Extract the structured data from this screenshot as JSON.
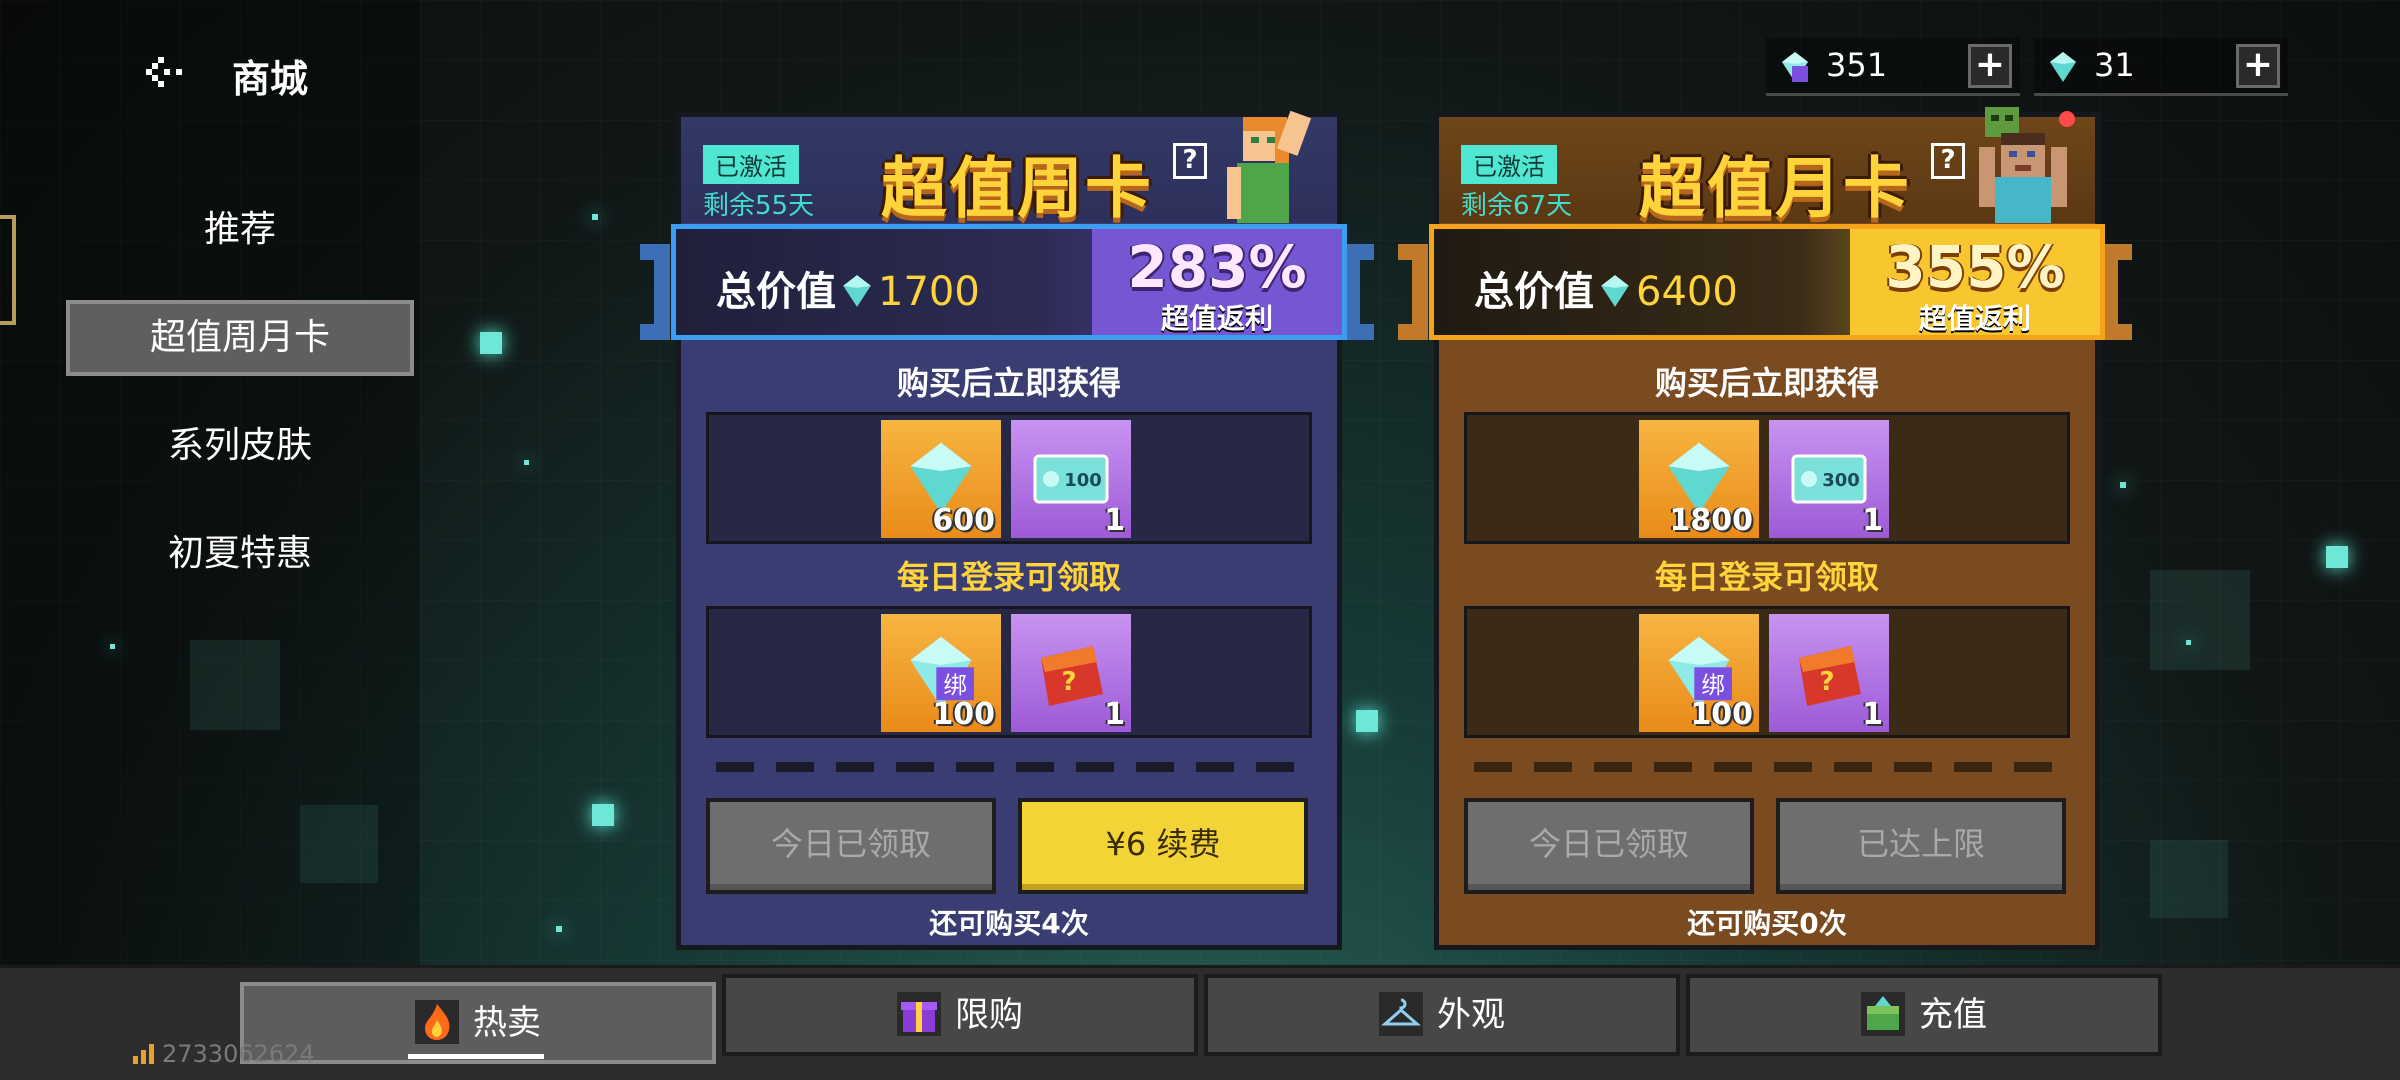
{
  "header": {
    "title": "商城",
    "back_icon": "back-arrow-icon"
  },
  "sidebar": {
    "items": [
      {
        "label": "推荐",
        "active": false
      },
      {
        "label": "超值周月卡",
        "active": true
      },
      {
        "label": "系列皮肤",
        "active": false
      },
      {
        "label": "初夏特惠",
        "active": false
      }
    ]
  },
  "currency": {
    "bound_diamonds": "351",
    "diamonds": "31"
  },
  "week_card": {
    "status": "已激活",
    "remaining": "剩余55天",
    "title": "超值周卡",
    "help": "?",
    "total_label": "总价值",
    "total_value": "1700",
    "percent": "283%",
    "percent_label": "超值返利",
    "immediate_title": "购买后立即获得",
    "immediate_items": [
      {
        "icon": "diamond-icon",
        "count": "600"
      },
      {
        "icon": "ticket-100-icon",
        "ticket_text": "100",
        "count": "1"
      }
    ],
    "daily_title": "每日登录可领取",
    "daily_items": [
      {
        "icon": "bound-diamond-icon",
        "count": "100",
        "bound_mark": "绑"
      },
      {
        "icon": "lucky-bag-icon",
        "count": "1"
      }
    ],
    "btn_left": "今日已领取",
    "btn_right": "¥6 续费",
    "hint": "还可购买4次"
  },
  "month_card": {
    "status": "已激活",
    "remaining": "剩余67天",
    "title": "超值月卡",
    "help": "?",
    "total_label": "总价值",
    "total_value": "6400",
    "percent": "355%",
    "percent_label": "超值返利",
    "immediate_title": "购买后立即获得",
    "immediate_items": [
      {
        "icon": "diamond-icon",
        "count": "1800"
      },
      {
        "icon": "ticket-300-icon",
        "ticket_text": "300",
        "count": "1"
      }
    ],
    "daily_title": "每日登录可领取",
    "daily_items": [
      {
        "icon": "bound-diamond-icon",
        "count": "100",
        "bound_mark": "绑"
      },
      {
        "icon": "lucky-bag-icon",
        "count": "1"
      }
    ],
    "btn_left": "今日已领取",
    "btn_right": "已达上限",
    "hint": "还可购买0次"
  },
  "bottom_tabs": [
    {
      "label": "热卖",
      "icon": "fire-icon",
      "active": true
    },
    {
      "label": "限购",
      "icon": "gift-box-icon",
      "active": false
    },
    {
      "label": "外观",
      "icon": "hanger-icon",
      "active": false
    },
    {
      "label": "充值",
      "icon": "chest-icon",
      "active": false
    }
  ],
  "footer": {
    "uid": "2733062624",
    "signal_icon": "signal-bars-icon"
  },
  "colors": {
    "accent_teal": "#4fe6d2",
    "gold": "#ffd33a",
    "week_blue": "#3c9df2",
    "month_orange": "#f4a41b"
  }
}
